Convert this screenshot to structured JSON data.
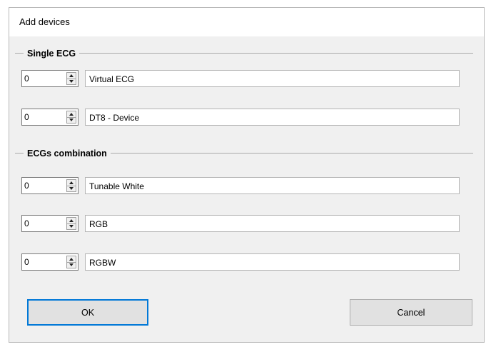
{
  "window": {
    "title": "Add devices"
  },
  "groups": {
    "single_ecg": {
      "legend": "Single ECG",
      "rows": [
        {
          "count": "0",
          "name": "Virtual ECG"
        },
        {
          "count": "0",
          "name": "DT8 - Device"
        }
      ]
    },
    "ecgs_combination": {
      "legend": "ECGs combination",
      "rows": [
        {
          "count": "0",
          "name": "Tunable White"
        },
        {
          "count": "0",
          "name": "RGB"
        },
        {
          "count": "0",
          "name": "RGBW"
        }
      ]
    }
  },
  "buttons": {
    "ok_label": "OK",
    "cancel_label": "Cancel"
  },
  "colors": {
    "focus_border": "#0078d7",
    "dialog_background": "#f0f0f0"
  }
}
